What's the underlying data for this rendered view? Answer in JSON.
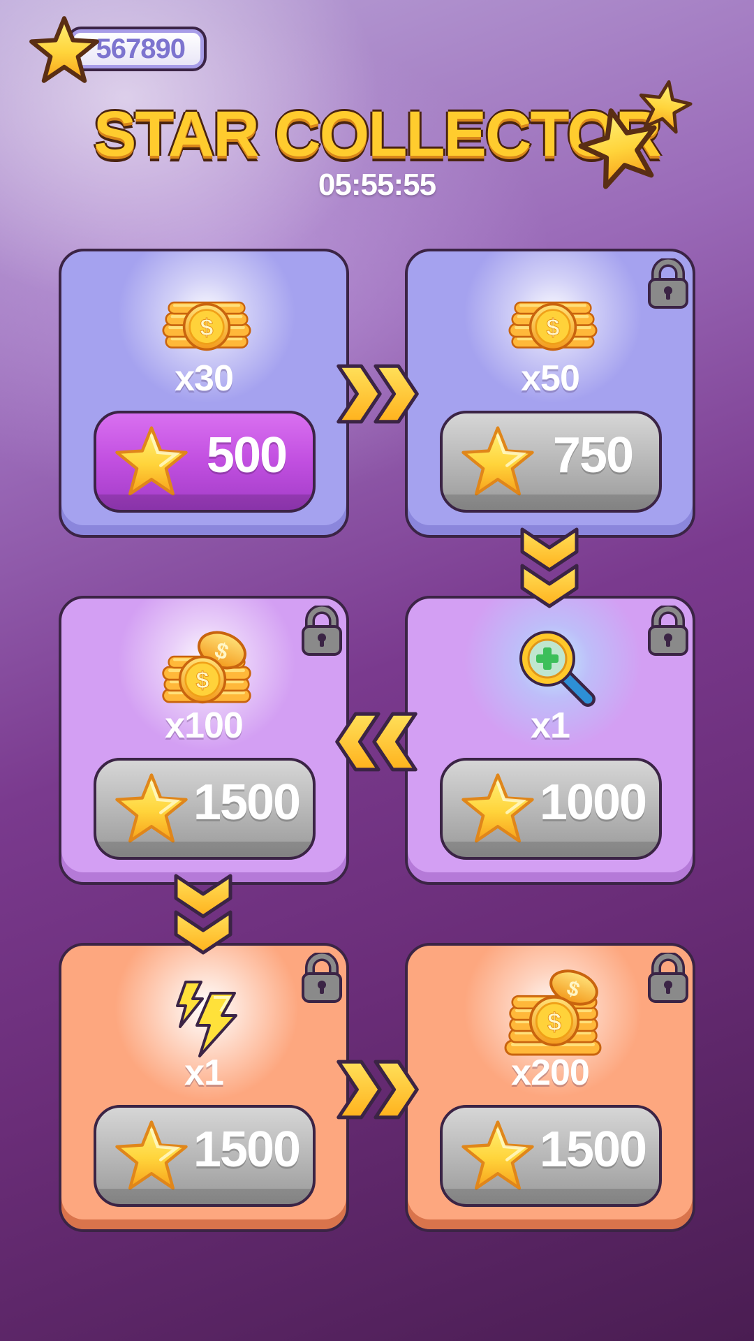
{
  "header": {
    "star_count": "567890",
    "title": "STAR COLLECTOR",
    "timer": "05:55:55"
  },
  "colors": {
    "star": "#ffd43b",
    "coin": "#ffb020",
    "tier1_card": "#a5a2ef",
    "tier2_card": "#d39ff3",
    "tier3_card": "#fda77f",
    "active_button": "#c14fe0",
    "locked_button": "#b8b8b8"
  },
  "rewards": [
    {
      "icon": "coin-stack-icon",
      "quantity": "x30",
      "price": "500",
      "locked": false,
      "state": "active"
    },
    {
      "icon": "coin-stack-icon",
      "quantity": "x50",
      "price": "750",
      "locked": true,
      "state": "locked"
    },
    {
      "icon": "magnifier-icon",
      "quantity": "x1",
      "price": "1000",
      "locked": true,
      "state": "locked"
    },
    {
      "icon": "coin-pile-icon",
      "quantity": "x100",
      "price": "1500",
      "locked": true,
      "state": "locked"
    },
    {
      "icon": "lightning-icon",
      "quantity": "x1",
      "price": "1500",
      "locked": true,
      "state": "locked"
    },
    {
      "icon": "coin-mountain-icon",
      "quantity": "x200",
      "price": "1500",
      "locked": true,
      "state": "locked"
    }
  ]
}
